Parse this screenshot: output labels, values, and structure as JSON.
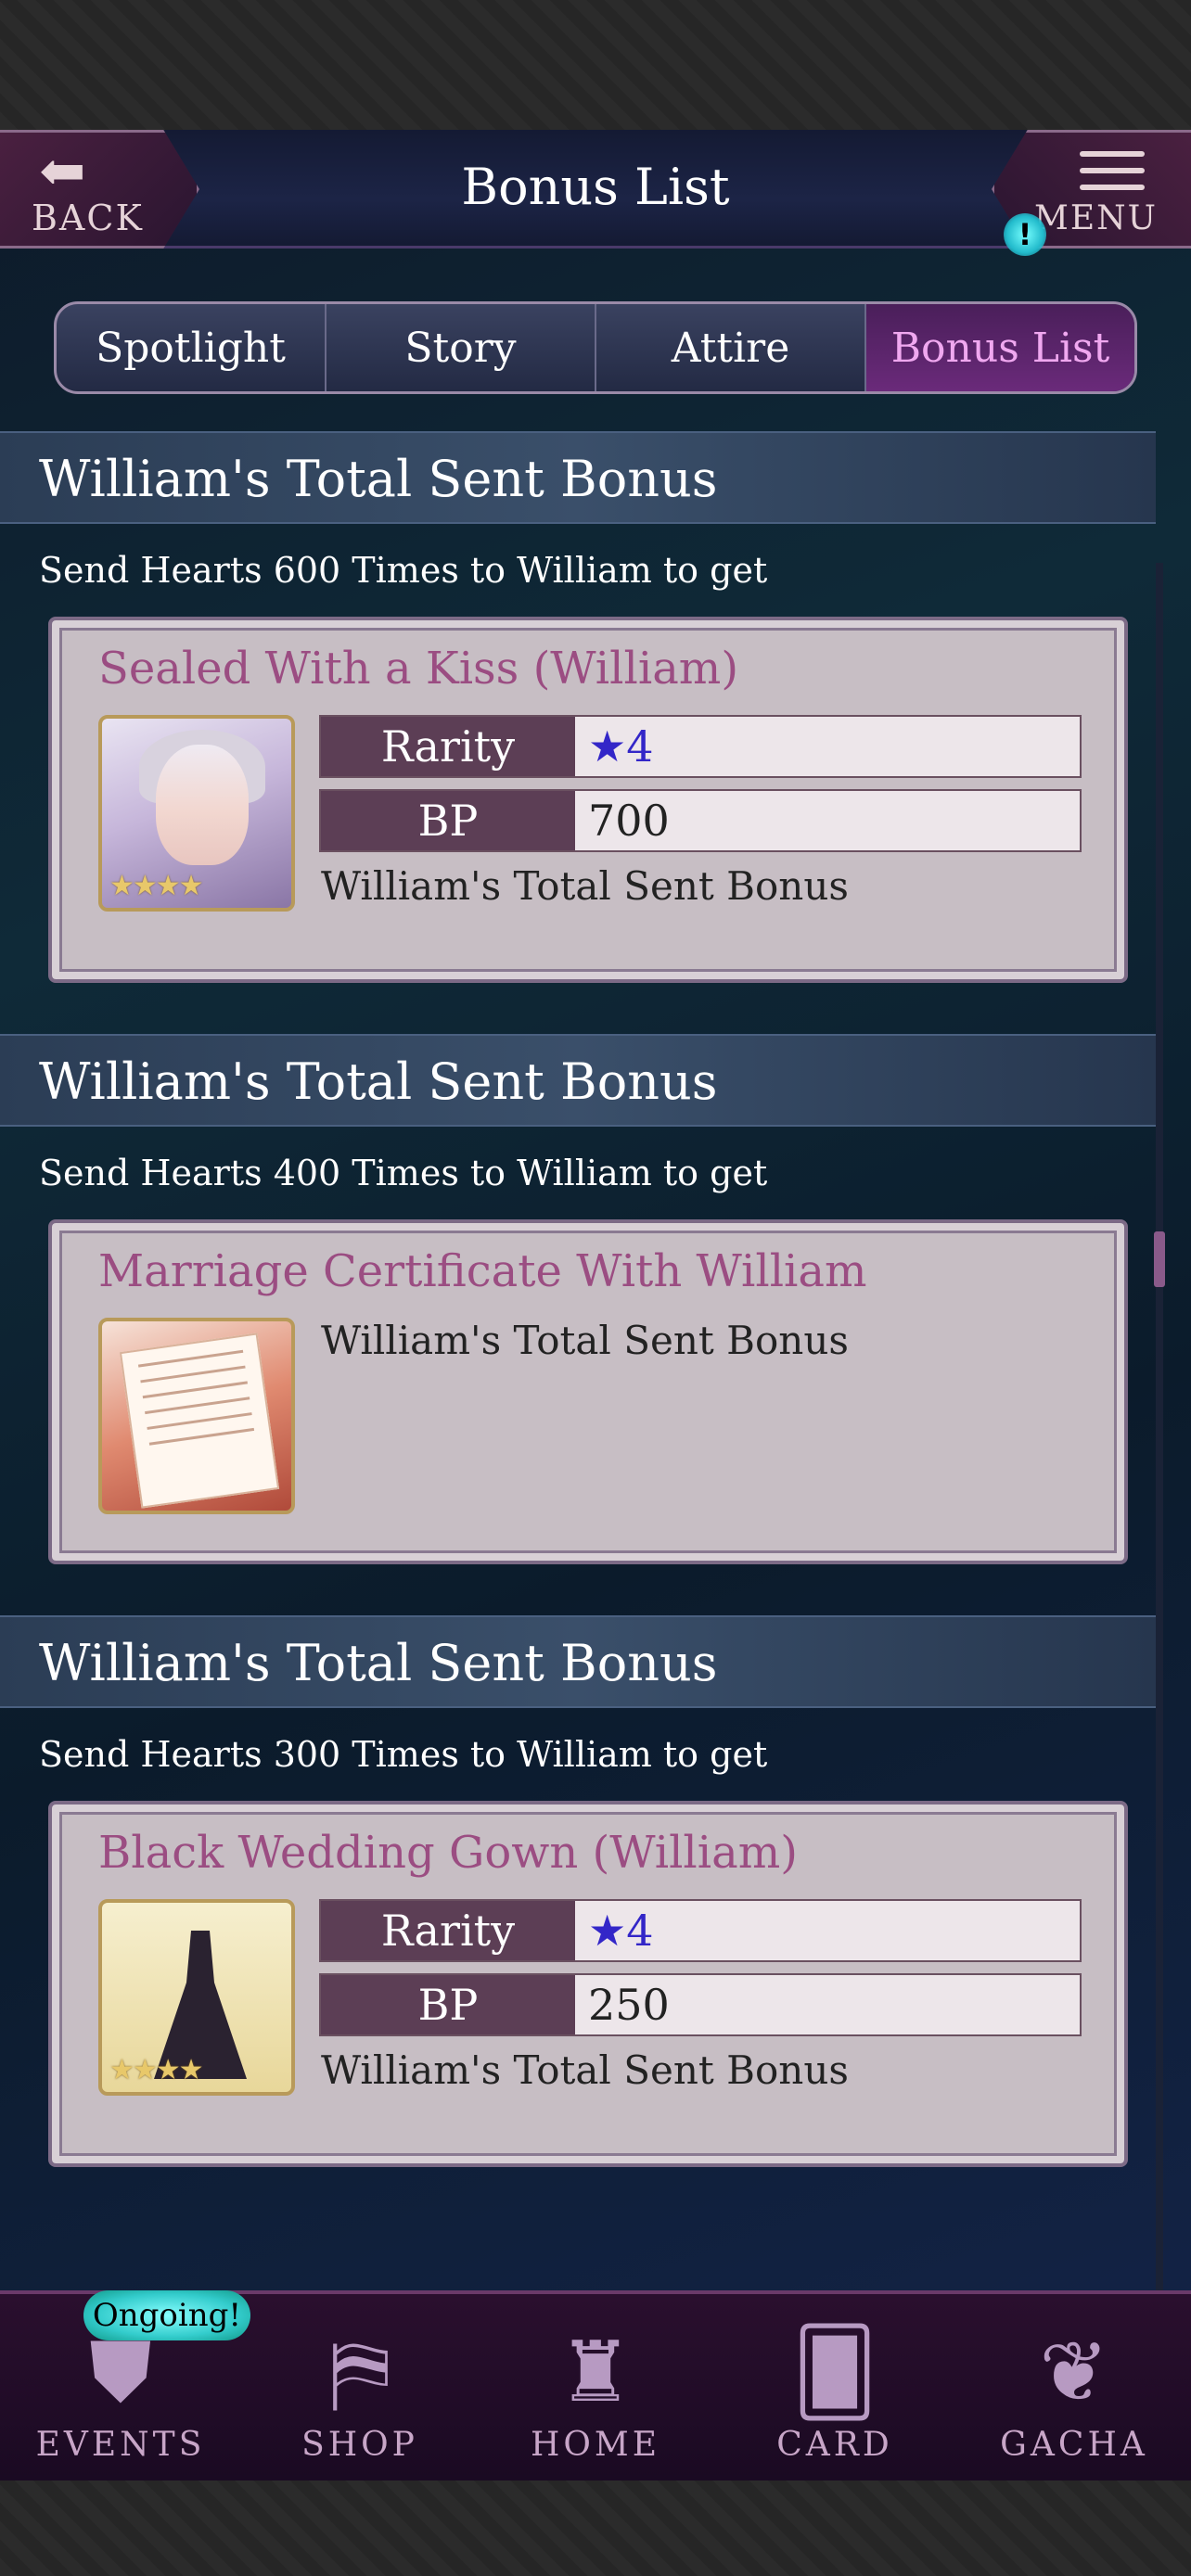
{
  "header": {
    "title": "Bonus List",
    "back_label": "BACK",
    "menu_label": "MENU",
    "alert_mark": "!"
  },
  "tabs": [
    {
      "label": "Spotlight",
      "active": false
    },
    {
      "label": "Story",
      "active": false
    },
    {
      "label": "Attire",
      "active": false
    },
    {
      "label": "Bonus List",
      "active": true
    }
  ],
  "bonuses": [
    {
      "section_title": "William's Total Sent Bonus",
      "condition": "Send Hearts 600 Times to William to get",
      "reward": {
        "name": "Sealed With a Kiss (William)",
        "rarity_label": "Rarity",
        "rarity_value": "★4",
        "bp_label": "BP",
        "bp_value": "700",
        "description": "William's Total Sent Bonus",
        "thumbnail": "card-portrait",
        "stars": "★★★★"
      }
    },
    {
      "section_title": "William's Total Sent Bonus",
      "condition": "Send Hearts 400 Times to William to get",
      "reward": {
        "name": "Marriage Certificate With William",
        "description": "William's Total Sent Bonus",
        "thumbnail": "certificate"
      }
    },
    {
      "section_title": "William's Total Sent Bonus",
      "condition": "Send Hearts 300 Times to William to get",
      "reward": {
        "name": "Black Wedding Gown (William)",
        "rarity_label": "Rarity",
        "rarity_value": "★4",
        "bp_label": "BP",
        "bp_value": "250",
        "description": "William's Total Sent Bonus",
        "thumbnail": "gown",
        "stars": "★★★★"
      }
    }
  ],
  "bottom_nav": {
    "badge": "Ongoing!",
    "items": [
      {
        "label": "EVENTS",
        "icon": "events-icon"
      },
      {
        "label": "SHOP",
        "icon": "shop-icon"
      },
      {
        "label": "HOME",
        "icon": "castle-icon"
      },
      {
        "label": "CARD",
        "icon": "card-icon"
      },
      {
        "label": "GACHA",
        "icon": "butterfly-icon"
      }
    ]
  },
  "colors": {
    "accent_pink": "#f0a8f0",
    "reward_title": "#9b4d82",
    "rarity_blue": "#3326c8",
    "label_bg": "#5c3e55"
  }
}
